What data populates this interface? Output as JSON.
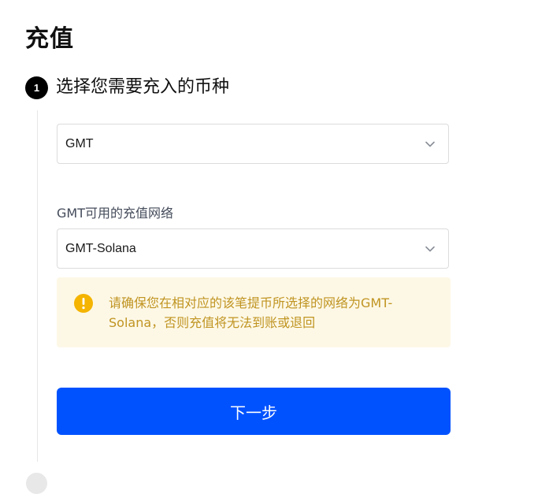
{
  "page": {
    "title": "充值"
  },
  "step1": {
    "number": "1",
    "title": "选择您需要充入的币种"
  },
  "coin_select": {
    "value": "GMT",
    "icon": "chevron-down-icon"
  },
  "network": {
    "label": "GMT可用的充值网络",
    "value": "GMT-Solana",
    "icon": "chevron-down-icon"
  },
  "warning": {
    "icon": "warning-icon",
    "text": "请确保您在相对应的该笔提币所选择的网络为GMT-Solana，否则充值将无法到账或退回"
  },
  "next_button": {
    "label": "下一步"
  },
  "colors": {
    "accent": "#0052ff",
    "warning_bg": "#fdf8e6",
    "warning_text": "#c09421",
    "warning_icon": "#f4b400"
  }
}
